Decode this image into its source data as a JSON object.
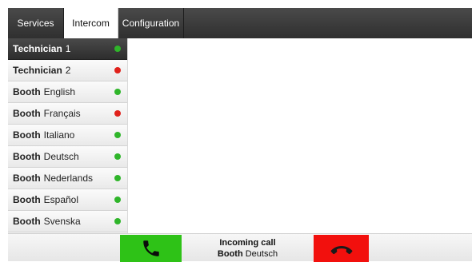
{
  "tabs": [
    {
      "label": "Services",
      "active": false
    },
    {
      "label": "Intercom",
      "active": true
    },
    {
      "label": "Configuration",
      "active": false
    }
  ],
  "sidebar": {
    "items": [
      {
        "lead": "Technician",
        "name": "1",
        "status": "online",
        "selected": true
      },
      {
        "lead": "Technician",
        "name": "2",
        "status": "offline",
        "selected": false
      },
      {
        "lead": "Booth",
        "name": "English",
        "status": "online",
        "selected": false
      },
      {
        "lead": "Booth",
        "name": "Français",
        "status": "offline",
        "selected": false
      },
      {
        "lead": "Booth",
        "name": "Italiano",
        "status": "online",
        "selected": false
      },
      {
        "lead": "Booth",
        "name": "Deutsch",
        "status": "online",
        "selected": false
      },
      {
        "lead": "Booth",
        "name": "Nederlands",
        "status": "online",
        "selected": false
      },
      {
        "lead": "Booth",
        "name": "Español",
        "status": "online",
        "selected": false
      },
      {
        "lead": "Booth",
        "name": "Svenska",
        "status": "online",
        "selected": false
      }
    ]
  },
  "call": {
    "title": "Incoming call",
    "caller_lead": "Booth",
    "caller_name": "Deutsch"
  },
  "colors": {
    "online": "#2fb52a",
    "offline": "#e0211b",
    "accept": "#2ec217",
    "reject": "#f2100d"
  },
  "icons": {
    "accept": "phone-accept-icon",
    "reject": "phone-hangup-icon"
  }
}
